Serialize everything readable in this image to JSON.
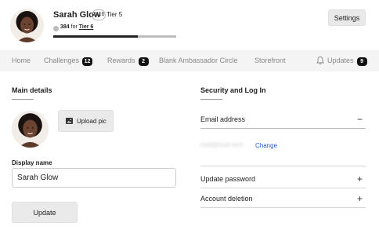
{
  "user": {
    "name": "Sarah Glow",
    "points": "2116",
    "tier": "Tier 5",
    "to_next_points": "384",
    "to_next_word": "for",
    "to_next_tier": "Tier 6",
    "progress_fraction": 0.69
  },
  "header": {
    "settings_label": "Settings"
  },
  "nav": {
    "items": [
      {
        "label": "Home"
      },
      {
        "label": "Challenges",
        "badge": "12"
      },
      {
        "label": "Rewards",
        "badge": "2"
      },
      {
        "label": "Blank Ambassador Circle"
      },
      {
        "label": "Storefront"
      }
    ],
    "updates": {
      "label": "Updates",
      "badge": "9"
    }
  },
  "main_details": {
    "title": "Main details",
    "upload_label": "Upload pic",
    "display_name_label": "Display name",
    "display_name_value": "Sarah Glow",
    "update_label": "Update"
  },
  "security": {
    "title": "Security and Log In",
    "email_label": "Email address",
    "email_value": "mail@dust tech",
    "change_label": "Change",
    "password_label": "Update password",
    "deletion_label": "Account deletion",
    "expanded_sign": "−",
    "collapsed_sign": "+"
  },
  "icons": {
    "bell": "bell-icon",
    "upload": "image-icon"
  }
}
